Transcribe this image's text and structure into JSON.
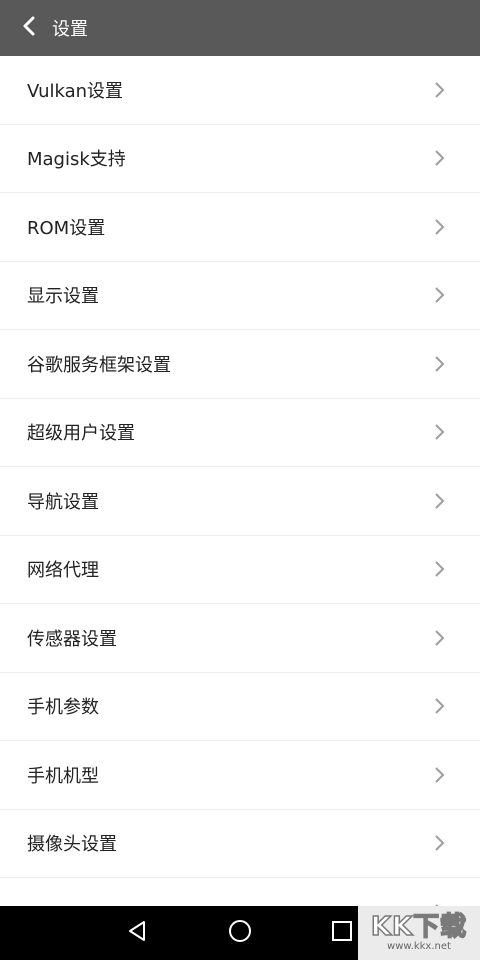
{
  "header": {
    "title": "设置",
    "back_icon": "chevron-left-icon"
  },
  "settings": {
    "items": [
      {
        "label": "Vulkan设置"
      },
      {
        "label": "Magisk支持"
      },
      {
        "label": "ROM设置"
      },
      {
        "label": "显示设置"
      },
      {
        "label": "谷歌服务框架设置"
      },
      {
        "label": "超级用户设置"
      },
      {
        "label": "导航设置"
      },
      {
        "label": "网络代理"
      },
      {
        "label": "传感器设置"
      },
      {
        "label": "手机参数"
      },
      {
        "label": "手机机型"
      },
      {
        "label": "摄像头设置"
      },
      {
        "label": ""
      }
    ]
  },
  "nav": {
    "back_icon": "triangle-back-icon",
    "home_icon": "circle-home-icon",
    "recent_icon": "square-recents-icon"
  },
  "watermark": {
    "main": "KK下载",
    "sub": "www.kkx.net"
  },
  "colors": {
    "app_bar": "#595959",
    "background": "#ffffff",
    "nav_bar": "#000000",
    "chevron": "#9e9e9e"
  }
}
